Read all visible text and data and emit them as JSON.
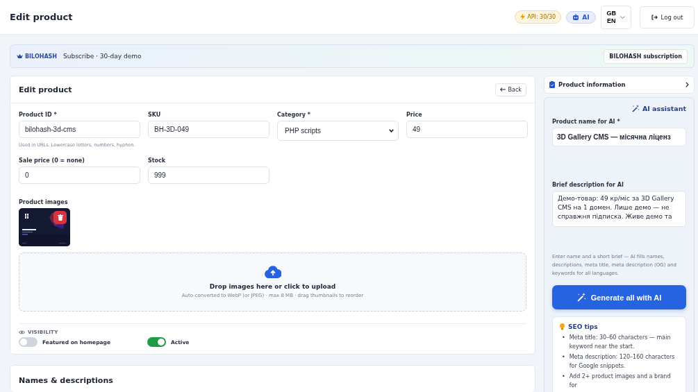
{
  "header": {
    "title": "Edit product",
    "api_badge": "API: 30/30",
    "ai_badge": "AI",
    "language": {
      "top": "GB",
      "bottom": "EN"
    },
    "logout": "Log out"
  },
  "banner": {
    "brand": "BILOHASH",
    "text": "Subscribe · 30-day demo",
    "button": "BILOHASH subscription"
  },
  "edit_card": {
    "title": "Edit product",
    "back": "Back",
    "fields": [
      {
        "kind": "input",
        "label": "Product ID *",
        "value": "bilohash-3d-cms",
        "hint": "Used in URLs. Lowercase letters, numbers, hyphen."
      },
      {
        "kind": "input",
        "label": "SKU",
        "value": "BH-3D-049"
      },
      {
        "kind": "select",
        "label": "Category *",
        "value": "PHP scripts"
      },
      {
        "kind": "input",
        "label": "Price",
        "value": "49"
      },
      {
        "kind": "input",
        "label": "Sale price (0 = none)",
        "value": "0"
      },
      {
        "kind": "input",
        "label": "Stock",
        "value": "999"
      }
    ],
    "images_label": "Product images",
    "dropzone": {
      "title": "Drop images here or click to upload",
      "hint": "Auto-converted to WebP (or JPEG) · max 8 MB · drag thumbnails to reorder"
    },
    "visibility": {
      "title": "VISIBILITY",
      "toggles": [
        {
          "label": "Featured on homepage",
          "on": false
        },
        {
          "label": "Active",
          "on": true
        }
      ]
    }
  },
  "names_card": {
    "title": "Names & descriptions"
  },
  "sidebar": {
    "section": {
      "title": "Product information",
      "expanded": false
    },
    "ai": {
      "title": "AI assistant",
      "name_label": "Product name for AI *",
      "name_value": "3D Gallery CMS — місячна ліценз",
      "brief_label": "Brief description for AI",
      "brief_value": "Демо-товар: 49 кр/міс за 3D Gallery CMS на 1 домен. Лише демо — не справжня підписка. Живе демо та",
      "help": "Enter name and a short brief — AI fills names, descriptions, meta title, meta description (OG) and keywords for all languages.",
      "generate": "Generate all with AI"
    },
    "seo": {
      "title": "SEO tips",
      "bullet": "•",
      "tips": [
        "Meta title: 30–60 characters — main keyword near the start.",
        "Meta description: 120–160 characters for Google snippets.",
        "Add 2+ product images and a brand for"
      ]
    }
  }
}
